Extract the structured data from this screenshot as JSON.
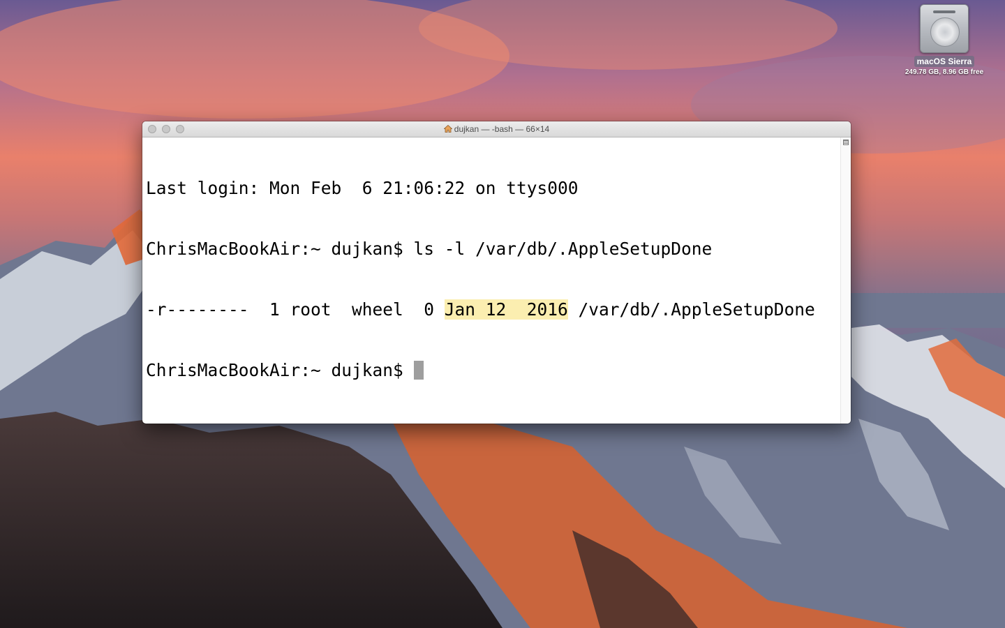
{
  "desktop": {
    "drive": {
      "name": "macOS Sierra",
      "info": "249.78 GB, 8.96 GB free",
      "icon": "hard-drive-icon"
    }
  },
  "terminal": {
    "title": "dujkan — -bash — 66×14",
    "title_icon": "home-icon",
    "highlight_color": "#fbeeb0",
    "lines": {
      "l1": "Last login: Mon Feb  6 21:06:22 on ttys000",
      "l2": "ChrisMacBookAir:~ dujkan$ ls -l /var/db/.AppleSetupDone",
      "l3_pre": "-r--------  1 root  wheel  0 ",
      "l3_hl": "Jan 12  2016",
      "l3_post": " /var/db/.AppleSetupDone",
      "l4": "ChrisMacBookAir:~ dujkan$ "
    }
  }
}
